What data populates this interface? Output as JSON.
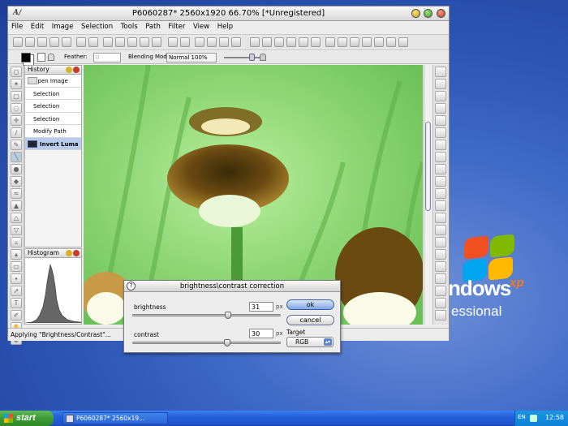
{
  "window": {
    "title": "P6060287* 2560x1920 66.70% [*Unregistered]"
  },
  "menu": [
    "File",
    "Edit",
    "Image",
    "Selection",
    "Tools",
    "Path",
    "Filter",
    "View",
    "Help"
  ],
  "options_bar": {
    "feather_label": "Feather:",
    "feather_value": "0",
    "blending_label": "Blending Mode:",
    "blending_value": "Normal 100%"
  },
  "history": {
    "title": "History",
    "items": [
      "Open Image",
      "Selection",
      "Selection",
      "Selection",
      "Modify Path",
      "Invert Luma"
    ],
    "selected_index": 5
  },
  "histogram": {
    "title": "Histogram"
  },
  "status": {
    "text": "Applying \"Brightness/Contrast\"..."
  },
  "dialog": {
    "title": "brightness\\contrast correction",
    "help_label": "?",
    "brightness_label": "brightness",
    "brightness_value": "31",
    "contrast_label": "contrast",
    "contrast_value": "30",
    "unit": "px",
    "ok_label": "ok",
    "cancel_label": "cancel",
    "target_label": "Target",
    "target_value": "RGB"
  },
  "desktop": {
    "xp_text": "ndows",
    "xp_sup": "xp",
    "xp_edition": "essional"
  },
  "taskbar": {
    "start_label": "start",
    "task_label": "P6060287* 2560x19...",
    "lang": "EN",
    "clock": "12:58"
  },
  "colors": {
    "taskbar": "#245edb",
    "start": "#3c9b35",
    "selection_highlight": "#b8cdee"
  }
}
